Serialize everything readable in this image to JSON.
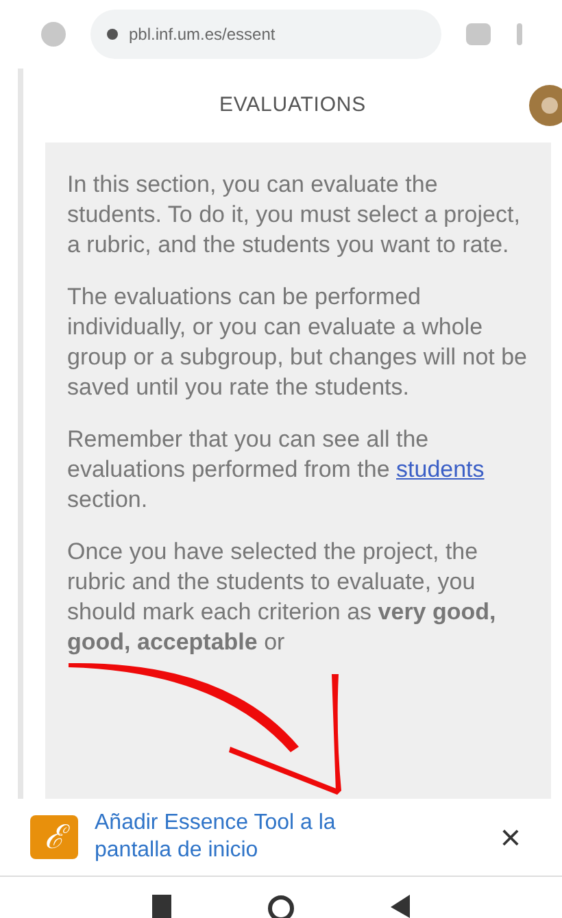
{
  "browser": {
    "url": "pbl.inf.um.es/essent"
  },
  "page": {
    "title": "EVALUATIONS",
    "paragraphs": [
      [
        {
          "kind": "plain",
          "text": "In this section, you can evaluate the students. To do it, you must select a project, a rubric, and the students you want to rate."
        }
      ],
      [
        {
          "kind": "plain",
          "text": "The evaluations can be performed individually, or you can evaluate a whole group or a subgroup, but changes will not be saved until you rate the students."
        }
      ],
      [
        {
          "kind": "plain",
          "text": "Remember that you can see all the evaluations performed from the "
        },
        {
          "kind": "link",
          "text": "students"
        },
        {
          "kind": "plain",
          "text": " section."
        }
      ],
      [
        {
          "kind": "plain",
          "text": "Once you have selected the project, the rubric and the students to evaluate, you should mark each criterion as **very good, good, acceptable** or"
        }
      ]
    ]
  },
  "banner": {
    "icon_letter": "ℰ",
    "text": "Añadir Essence Tool a la pantalla de inicio",
    "close": "×"
  }
}
